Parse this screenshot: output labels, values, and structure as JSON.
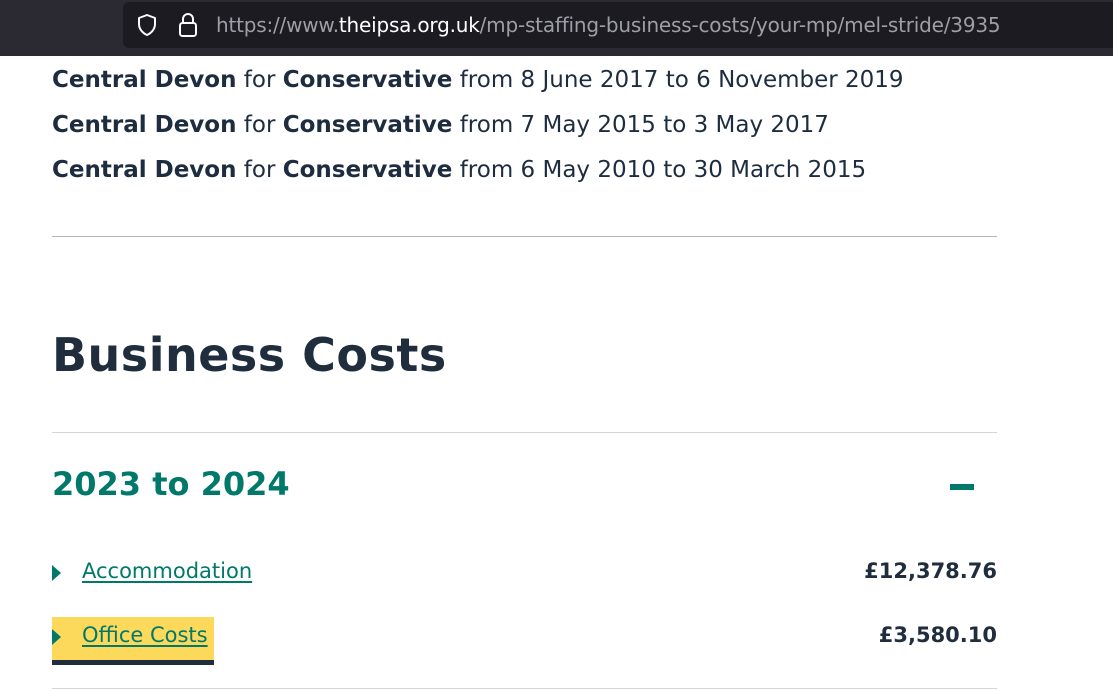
{
  "browser": {
    "url_scheme": "https://www.",
    "url_host": "theipsa.org.uk",
    "url_path": "/mp-staffing-business-costs/your-mp/mel-stride/3935",
    "icons": [
      "shield-icon",
      "lock-icon"
    ]
  },
  "terms": [
    {
      "constituency": "Central Devon",
      "for": "for",
      "party": "Conservative",
      "dates": "from 8 June 2017 to 6 November 2019"
    },
    {
      "constituency": "Central Devon",
      "for": "for",
      "party": "Conservative",
      "dates": "from 7 May 2015 to 3 May 2017"
    },
    {
      "constituency": "Central Devon",
      "for": "for",
      "party": "Conservative",
      "dates": "from 6 May 2010 to 30 March 2015"
    }
  ],
  "business_costs": {
    "title": "Business Costs",
    "year_label": "2023 to 2024",
    "toggle_icon": "minus-icon",
    "items": [
      {
        "label": "Accommodation",
        "amount": "£12,378.76",
        "focused": false
      },
      {
        "label": "Office Costs",
        "amount": "£3,580.10",
        "focused": true
      }
    ]
  },
  "colors": {
    "accent": "#00796b",
    "text": "#1f2d3d",
    "focus": "#fcd95a"
  }
}
